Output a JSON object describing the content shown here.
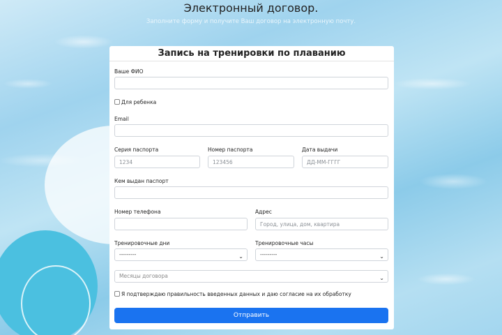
{
  "header": {
    "title": "Электронный договор.",
    "subtitle": "Заполните форму и получите Ваш договор на электронную почту."
  },
  "form": {
    "title": "Запись на тренировки по плаванию",
    "fio_label": "Ваше ФИО",
    "child_label": "Для ребенка",
    "email_label": "Email",
    "passport_series_label": "Серия паспорта",
    "passport_series_placeholder": "1234",
    "passport_number_label": "Номер паспорта",
    "passport_number_placeholder": "123456",
    "issue_date_label": "Дата выдачи",
    "issue_date_placeholder": "ДД-ММ-ГГГГ",
    "issued_by_label": "Кем выдан паспорт",
    "phone_label": "Номер телефона",
    "address_label": "Адрес",
    "address_placeholder": "Город, улица, дом, квартира",
    "training_days_label": "Тренировочные дни",
    "training_days_value": "---------",
    "training_hours_label": "Тренировочные часы",
    "training_hours_value": "---------",
    "months_placeholder": "Месяцы договора",
    "consent_label": "Я подтверждаю правильность введенных данных и даю согласие на их обработку",
    "submit_label": "Отправить"
  },
  "icons": {
    "select_arrow": "chevron-down-icon"
  }
}
